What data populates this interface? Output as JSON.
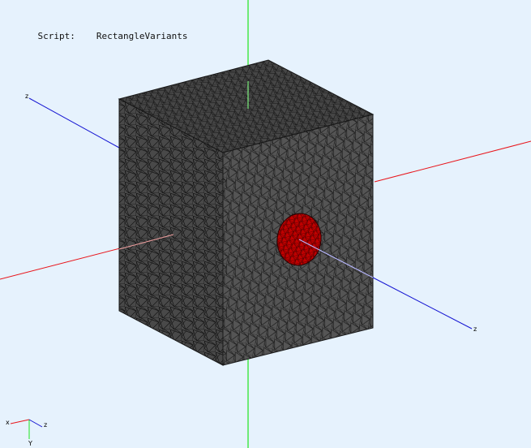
{
  "script": {
    "label": "Script:",
    "value": "RectangleVariants"
  },
  "axes": {
    "x_label": "x",
    "y_label": "Y",
    "z_label": "z",
    "z_end_label": "z",
    "colors": {
      "x": "#e8151b",
      "y": "#1ee51e",
      "z": "#1414d2"
    }
  },
  "orientation_triad": {
    "x_label": "x",
    "y_label": "Y",
    "z_label": "z"
  },
  "mesh": {
    "color": "#4a4a4a",
    "edge_color": "#111111",
    "highlight_color": "#c00000"
  },
  "background_color": "#e6f2fd"
}
